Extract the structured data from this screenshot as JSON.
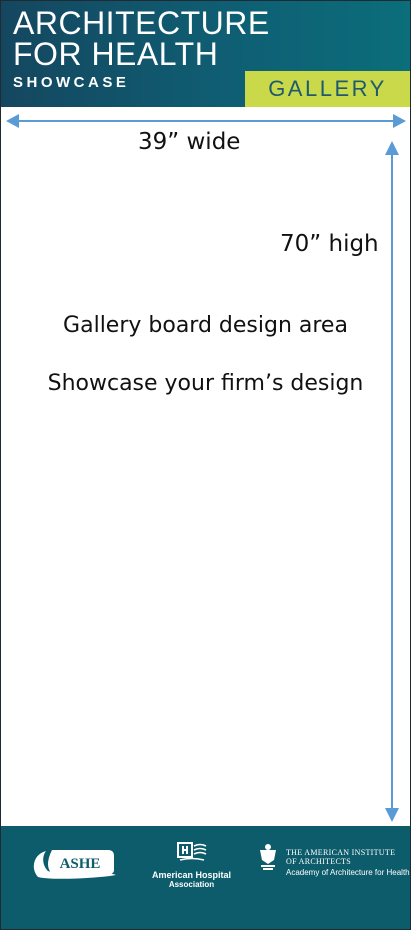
{
  "header": {
    "title_line1": "ARCHITECTURE",
    "title_line2": "FOR HEALTH",
    "subtitle": "SHOWCASE",
    "tag": "GALLERY"
  },
  "dimensions": {
    "width_label": "39” wide",
    "height_label": "70” high"
  },
  "content": {
    "design_area": "Gallery board design area",
    "showcase": "Showcase your firm’s design"
  },
  "footer": {
    "ashe_logo": "ASHE",
    "aha_line1": "American Hospital",
    "aha_line2": "Association",
    "aia_line1": "THE AMERICAN INSTITUTE",
    "aia_line2": "OF ARCHITECTS",
    "aia_line3": "Academy of Architecture for Health"
  },
  "colors": {
    "header_bg": "#14475f",
    "gallery_tag_bg": "#c9d94a",
    "footer_bg": "#0d5c6b",
    "arrow": "#5b9bd5"
  }
}
